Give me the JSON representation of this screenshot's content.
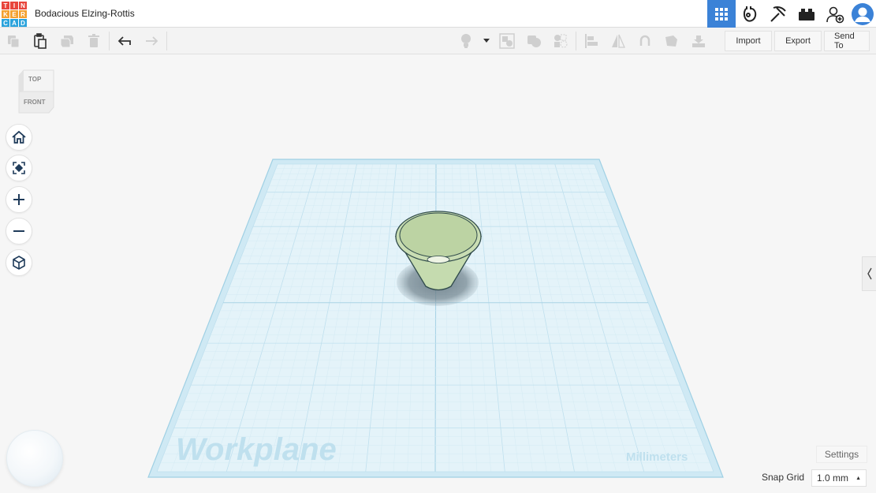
{
  "app": {
    "logo_letters": [
      "T",
      "I",
      "N",
      "K",
      "E",
      "R",
      "C",
      "A",
      "D"
    ],
    "logo_colors": [
      "#e8453c",
      "#e8453c",
      "#e8453c",
      "#f4a130",
      "#f4a130",
      "#f4a130",
      "#2ba3dc",
      "#2ba3dc",
      "#2ba3dc"
    ],
    "design_title": "Bodacious Elzing-Rottis"
  },
  "top_icons": [
    {
      "name": "3d-design-grid-icon",
      "active": true
    },
    {
      "name": "circuits-icon",
      "active": false
    },
    {
      "name": "minecraft-pickaxe-icon",
      "active": false
    },
    {
      "name": "brick-icon",
      "active": false
    },
    {
      "name": "add-user-icon",
      "active": false
    }
  ],
  "toolbar": {
    "import_label": "Import",
    "export_label": "Export",
    "send_to_label": "Send To"
  },
  "viewcube": {
    "top_label": "TOP",
    "front_label": "FRONT"
  },
  "workplane": {
    "label": "Workplane",
    "units_label": "Millimeters"
  },
  "settings": {
    "settings_label": "Settings",
    "snap_grid_label": "Snap Grid",
    "snap_grid_value": "1.0 mm"
  },
  "colors": {
    "accent": "#3b82d7",
    "workplane_fill": "#dff1f8",
    "grid_line": "#bfe0ee",
    "shape_fill": "#c9ddb3",
    "shape_stroke": "#2f4a4a"
  }
}
